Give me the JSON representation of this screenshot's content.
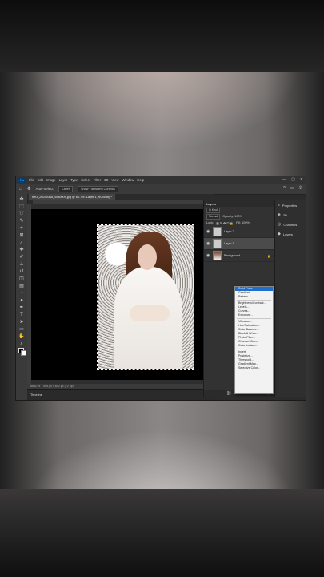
{
  "menubar": {
    "logo": "Ps",
    "items": [
      "File",
      "Edit",
      "Image",
      "Layer",
      "Type",
      "Select",
      "Filter",
      "3D",
      "View",
      "Window",
      "Help"
    ],
    "window_controls": [
      "—",
      "▢",
      "✕"
    ]
  },
  "options": {
    "auto_select_label": "Auto-Select:",
    "target": "Layer",
    "show_transform": "Show Transform Controls"
  },
  "document_tab": {
    "title": "IMG_20240316_WA0009.jpg @ 66.7% (Layer 1, RGB/8#) *"
  },
  "statusbar": {
    "zoom": "66.67%",
    "info": "596 px x 842 px (72 ppi)"
  },
  "timeline": {
    "label": "Timeline"
  },
  "layers_panel": {
    "tab": "Layers",
    "kind_label": "Q Kind",
    "blend_mode": "Normal",
    "opacity_label": "Opacity: 100%",
    "lock_label": "Lock:",
    "fill_label": "Fill: 100%",
    "layers": [
      {
        "name": "Layer 2",
        "selected": false
      },
      {
        "name": "Layer 1",
        "selected": true
      },
      {
        "name": "Background",
        "selected": false
      }
    ],
    "footer_icons": [
      "link-icon",
      "fx-icon",
      "mask-icon",
      "adjustment-icon",
      "folder-icon",
      "new-layer-icon",
      "trash-icon"
    ]
  },
  "right_dock": {
    "items": [
      "Properties",
      "3D",
      "Channels",
      "Layers"
    ]
  },
  "adjustment_menu": {
    "groups": [
      [
        "Solid Color...",
        "Gradient...",
        "Pattern..."
      ],
      [
        "Brightness/Contrast...",
        "Levels...",
        "Curves...",
        "Exposure..."
      ],
      [
        "Vibrance...",
        "Hue/Saturation...",
        "Color Balance...",
        "Black & White...",
        "Photo Filter...",
        "Channel Mixer...",
        "Color Lookup..."
      ],
      [
        "Invert",
        "Posterize...",
        "Threshold...",
        "Gradient Map...",
        "Selective Color..."
      ]
    ],
    "active": "Solid Color..."
  }
}
